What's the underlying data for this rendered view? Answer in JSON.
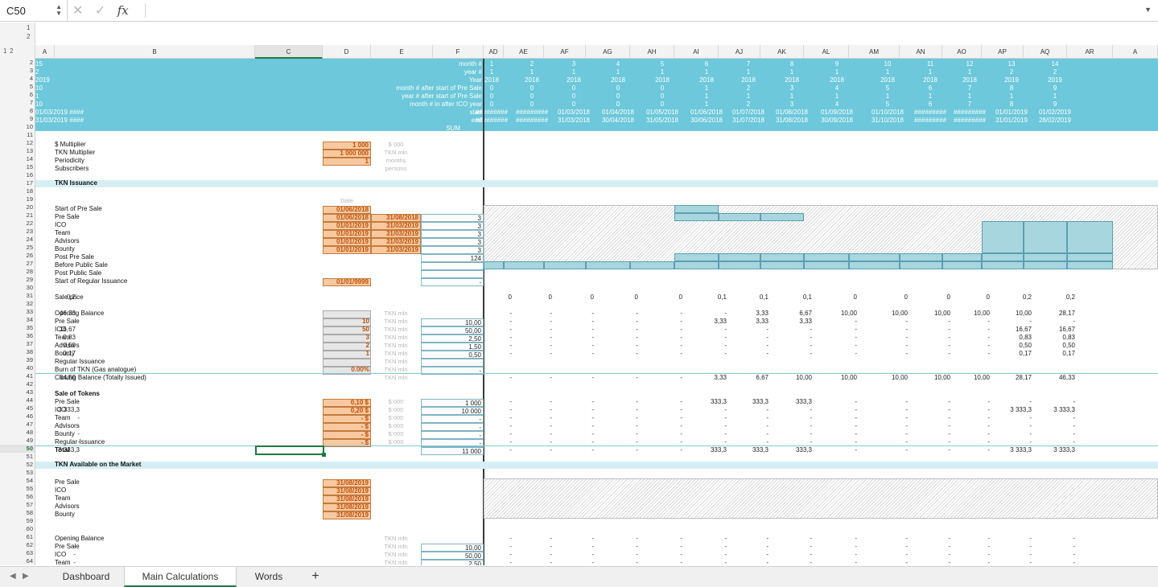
{
  "cell_ref": "C50",
  "formula_icons": {
    "cancel": "✕",
    "confirm": "✓",
    "fx": "fx",
    "expand": "▼"
  },
  "outline_levels": [
    "1",
    "2"
  ],
  "col_outline_levels": [
    "1",
    "2"
  ],
  "columns": [
    "A",
    "B",
    "C",
    "D",
    "E",
    "F",
    "AD",
    "AE",
    "AF",
    "AG",
    "AH",
    "AI",
    "AJ",
    "AK",
    "AL",
    "AM",
    "AN",
    "AO",
    "AP",
    "AQ",
    "AR",
    "A"
  ],
  "selected_column": "C",
  "rows": [
    "2",
    "3",
    "4",
    "5",
    "6",
    "7",
    "8",
    "9",
    "10",
    "11",
    "12",
    "13",
    "14",
    "15",
    "16",
    "17",
    "18",
    "19",
    "20",
    "21",
    "22",
    "23",
    "24",
    "25",
    "26",
    "27",
    "28",
    "29",
    "30",
    "31",
    "32",
    "33",
    "34",
    "35",
    "36",
    "37",
    "38",
    "39",
    "40",
    "41",
    "42",
    "43",
    "44",
    "45",
    "46",
    "47",
    "48",
    "49",
    "50",
    "51",
    "52",
    "53",
    "54",
    "55",
    "56",
    "57",
    "58",
    "59",
    "60",
    "61",
    "62",
    "63",
    "64"
  ],
  "selected_row": "50",
  "header_labels": [
    "month #",
    "year #",
    "Year",
    "month # after start of Pre Sale",
    "year # after start of Pre Sale",
    "month # in after ICO year",
    "start",
    "end"
  ],
  "sum_label": "SUM",
  "timeline": {
    "month": [
      "1",
      "2",
      "3",
      "4",
      "5",
      "6",
      "7",
      "8",
      "9",
      "10",
      "11",
      "12",
      "13",
      "14",
      "15"
    ],
    "year": [
      "1",
      "1",
      "1",
      "1",
      "1",
      "1",
      "1",
      "1",
      "1",
      "1",
      "1",
      "1",
      "2",
      "2",
      "2"
    ],
    "Year": [
      "2018",
      "2018",
      "2018",
      "2018",
      "2018",
      "2018",
      "2018",
      "2018",
      "2018",
      "2018",
      "2018",
      "2018",
      "2019",
      "2019",
      "2019"
    ],
    "m_after_presale": [
      "0",
      "0",
      "0",
      "0",
      "0",
      "1",
      "2",
      "3",
      "4",
      "5",
      "6",
      "7",
      "8",
      "9",
      "10"
    ],
    "y_after_presale": [
      "0",
      "0",
      "0",
      "0",
      "0",
      "1",
      "1",
      "1",
      "1",
      "1",
      "1",
      "1",
      "1",
      "1",
      "1"
    ],
    "m_after_ico": [
      "0",
      "0",
      "0",
      "0",
      "0",
      "1",
      "2",
      "3",
      "4",
      "5",
      "6",
      "7",
      "8",
      "9",
      "10"
    ],
    "start": [
      "#########",
      "#########",
      "01/03/2018",
      "01/04/2018",
      "01/05/2018",
      "01/06/2018",
      "01/07/2018",
      "01/08/2018",
      "01/09/2018",
      "01/10/2018",
      "#########",
      "#########",
      "01/01/2019",
      "01/02/2019",
      "01/03/2019 ####"
    ],
    "end": [
      "#########",
      "#########",
      "31/03/2018",
      "30/04/2018",
      "31/05/2018",
      "30/06/2018",
      "31/07/2018",
      "31/08/2018",
      "30/09/2018",
      "31/10/2018",
      "#########",
      "#########",
      "31/01/2019",
      "28/02/2019",
      "31/03/2019 ####"
    ]
  },
  "params": [
    {
      "label": "$ Multiplier",
      "value": "1 000",
      "unit": "$ 000"
    },
    {
      "label": "TKN Multiplier",
      "value": "1 000 000",
      "unit": "TKN mln"
    },
    {
      "label": "Periodicity",
      "value": "1",
      "unit": "months"
    },
    {
      "label": "Subscribers",
      "value": "",
      "unit": "persons"
    }
  ],
  "sec_issuance": "TKN Issuance",
  "issuance_date_hdr": "Date",
  "issuance": [
    {
      "label": "Start of Pre Sale",
      "d": "01/06/2018",
      "e": "",
      "f": ""
    },
    {
      "label": "Pre Sale",
      "d": "01/06/2018",
      "e": "31/08/2018",
      "f": "3"
    },
    {
      "label": "ICO",
      "d": "01/01/2019",
      "e": "31/03/2019",
      "f": "3"
    },
    {
      "label": "Team",
      "d": "01/01/2019",
      "e": "31/03/2019",
      "f": "3"
    },
    {
      "label": "Advisors",
      "d": "01/01/2019",
      "e": "31/03/2019",
      "f": "3"
    },
    {
      "label": "Bounty",
      "d": "01/01/2019",
      "e": "31/03/2019",
      "f": "3"
    },
    {
      "label": "Post Pre Sale",
      "d": "",
      "e": "",
      "f": "124"
    },
    {
      "label": "Before Public Sale",
      "d": "",
      "e": "",
      "f": ""
    },
    {
      "label": "Post Public Sale",
      "d": "",
      "e": "",
      "f": ""
    },
    {
      "label": "Start of Regular Issuance",
      "d": "01/01/9999",
      "e": "",
      "f": "-"
    }
  ],
  "sale_price_label": "Sale price",
  "sale_price": [
    "0",
    "0",
    "0",
    "0",
    "0",
    "0,1",
    "0,1",
    "0,1",
    "0",
    "0",
    "0",
    "0",
    "0,2",
    "0,2",
    "0,2"
  ],
  "balance": [
    {
      "label": "Opening Balance",
      "d": "",
      "unit": "TKN mln",
      "f": "",
      "vals": [
        "-",
        "-",
        "-",
        "-",
        "-",
        "-",
        "3,33",
        "6,67",
        "10,00",
        "10,00",
        "10,00",
        "10,00",
        "10,00",
        "28,17",
        "46,33"
      ]
    },
    {
      "label": "Pre Sale",
      "d": "10",
      "unit": "TKN mln",
      "f": "10,00",
      "vals": [
        "-",
        "-",
        "-",
        "-",
        "-",
        "3,33",
        "3,33",
        "3,33",
        "-",
        "-",
        "-",
        "-",
        "-",
        "-",
        "-"
      ]
    },
    {
      "label": "ICO",
      "d": "50",
      "unit": "TKN mln",
      "f": "50,00",
      "vals": [
        "-",
        "-",
        "-",
        "-",
        "-",
        "-",
        "-",
        "-",
        "-",
        "-",
        "-",
        "-",
        "16,67",
        "16,67",
        "16,67"
      ]
    },
    {
      "label": "Team",
      "d": "3",
      "unit": "TKN mln",
      "f": "2,50",
      "vals": [
        "-",
        "-",
        "-",
        "-",
        "-",
        "-",
        "-",
        "-",
        "-",
        "-",
        "-",
        "-",
        "0,83",
        "0,83",
        "0,83"
      ]
    },
    {
      "label": "Advisors",
      "d": "2",
      "unit": "TKN mln",
      "f": "1,50",
      "vals": [
        "-",
        "-",
        "-",
        "-",
        "-",
        "-",
        "-",
        "-",
        "-",
        "-",
        "-",
        "-",
        "0,50",
        "0,50",
        "0,50"
      ]
    },
    {
      "label": "Bounty",
      "d": "1",
      "unit": "TKN mln",
      "f": "0,50",
      "vals": [
        "-",
        "-",
        "-",
        "-",
        "-",
        "-",
        "-",
        "-",
        "-",
        "-",
        "-",
        "-",
        "0,17",
        "0,17",
        "0,17"
      ]
    },
    {
      "label": "Regular Issuance",
      "d": "",
      "unit": "TKN mln",
      "f": "",
      "vals": [
        "",
        "",
        "",
        "",
        "",
        "",
        "",
        "",
        "",
        "",
        "",
        "",
        "",
        "",
        ""
      ]
    },
    {
      "label": "Burn of TKN (Gas analogue)",
      "d": "0.00%",
      "unit": "TKN mln",
      "f": "-",
      "vals": [
        "",
        "",
        "",
        "",
        "",
        "",
        "",
        "",
        "",
        "",
        "",
        "",
        "",
        "",
        ""
      ]
    },
    {
      "label": "Closing Balance (Totally Issued)",
      "d": "",
      "unit": "TKN mln",
      "f": "",
      "vals": [
        "-",
        "-",
        "-",
        "-",
        "-",
        "3,33",
        "6,67",
        "10,00",
        "10,00",
        "10,00",
        "10,00",
        "10,00",
        "28,17",
        "46,33",
        "64,50"
      ]
    }
  ],
  "sale_tokens_label": "Sale of Tokens",
  "sale_tokens": [
    {
      "label": "Pre Sale",
      "d": "0,10 $",
      "unit": "$ 000",
      "f": "1 000",
      "vals": [
        "-",
        "-",
        "-",
        "-",
        "-",
        "333,3",
        "333,3",
        "333,3",
        "-",
        "-",
        "-",
        "-",
        "-",
        "-",
        "-"
      ]
    },
    {
      "label": "ICO",
      "d": "0,20 $",
      "unit": "$ 000",
      "f": "10 000",
      "vals": [
        "-",
        "-",
        "-",
        "-",
        "-",
        "-",
        "-",
        "-",
        "-",
        "-",
        "-",
        "-",
        "3 333,3",
        "3 333,3",
        "3 333,3"
      ]
    },
    {
      "label": "Team",
      "d": "-  $",
      "unit": "$ 000",
      "f": "-",
      "vals": [
        "-",
        "-",
        "-",
        "-",
        "-",
        "-",
        "-",
        "-",
        "-",
        "-",
        "-",
        "-",
        "-",
        "-",
        "-"
      ]
    },
    {
      "label": "Advisors",
      "d": "-  $",
      "unit": "$ 000",
      "f": "-",
      "vals": [
        "-",
        "-",
        "-",
        "-",
        "-",
        "-",
        "-",
        "-",
        "-",
        "-",
        "-",
        "-",
        "-",
        "-",
        "-"
      ]
    },
    {
      "label": "Bounty",
      "d": "-  $",
      "unit": "$ 000",
      "f": "-",
      "vals": [
        "-",
        "-",
        "-",
        "-",
        "-",
        "-",
        "-",
        "-",
        "-",
        "-",
        "-",
        "-",
        "-",
        "-",
        "-"
      ]
    },
    {
      "label": "Regular Issuance",
      "d": "-  $",
      "unit": "$ 000",
      "f": "-",
      "vals": [
        "-",
        "-",
        "-",
        "-",
        "-",
        "-",
        "-",
        "-",
        "-",
        "-",
        "-",
        "-",
        "-",
        "-",
        "-"
      ]
    },
    {
      "label": "Total",
      "d": "",
      "unit": "",
      "f": "11 000",
      "vals": [
        "-",
        "-",
        "-",
        "-",
        "-",
        "333,3",
        "333,3",
        "333,3",
        "-",
        "-",
        "-",
        "-",
        "3 333,3",
        "3 333,3",
        "3 333,3"
      ]
    }
  ],
  "sec_market": "TKN Available on the Market",
  "market": [
    {
      "label": "Pre Sale",
      "d": "31/08/2019"
    },
    {
      "label": "ICO",
      "d": "31/08/2019"
    },
    {
      "label": "Team",
      "d": "31/08/2019"
    },
    {
      "label": "Advisors",
      "d": "31/08/2019"
    },
    {
      "label": "Bounty",
      "d": "31/08/2019"
    }
  ],
  "market_balance": [
    {
      "label": "Opening Balance",
      "unit": "TKN mln",
      "f": ""
    },
    {
      "label": "Pre Sale",
      "unit": "TKN mln",
      "f": "10,00"
    },
    {
      "label": "ICO",
      "unit": "TKN mln",
      "f": "50,00"
    },
    {
      "label": "Team",
      "unit": "TKN mln",
      "f": "2,50"
    }
  ],
  "tabs": [
    "Dashboard",
    "Main Calculations",
    "Words"
  ],
  "active_tab": "Main Calculations",
  "add_sheet": "+",
  "nav_prev": "◀",
  "nav_next": "▶",
  "colors": {
    "header_band": "#6cc8da",
    "section_band": "#d6eff5",
    "input_orange": "#f8c9a0",
    "selection": "#1e7a42"
  }
}
